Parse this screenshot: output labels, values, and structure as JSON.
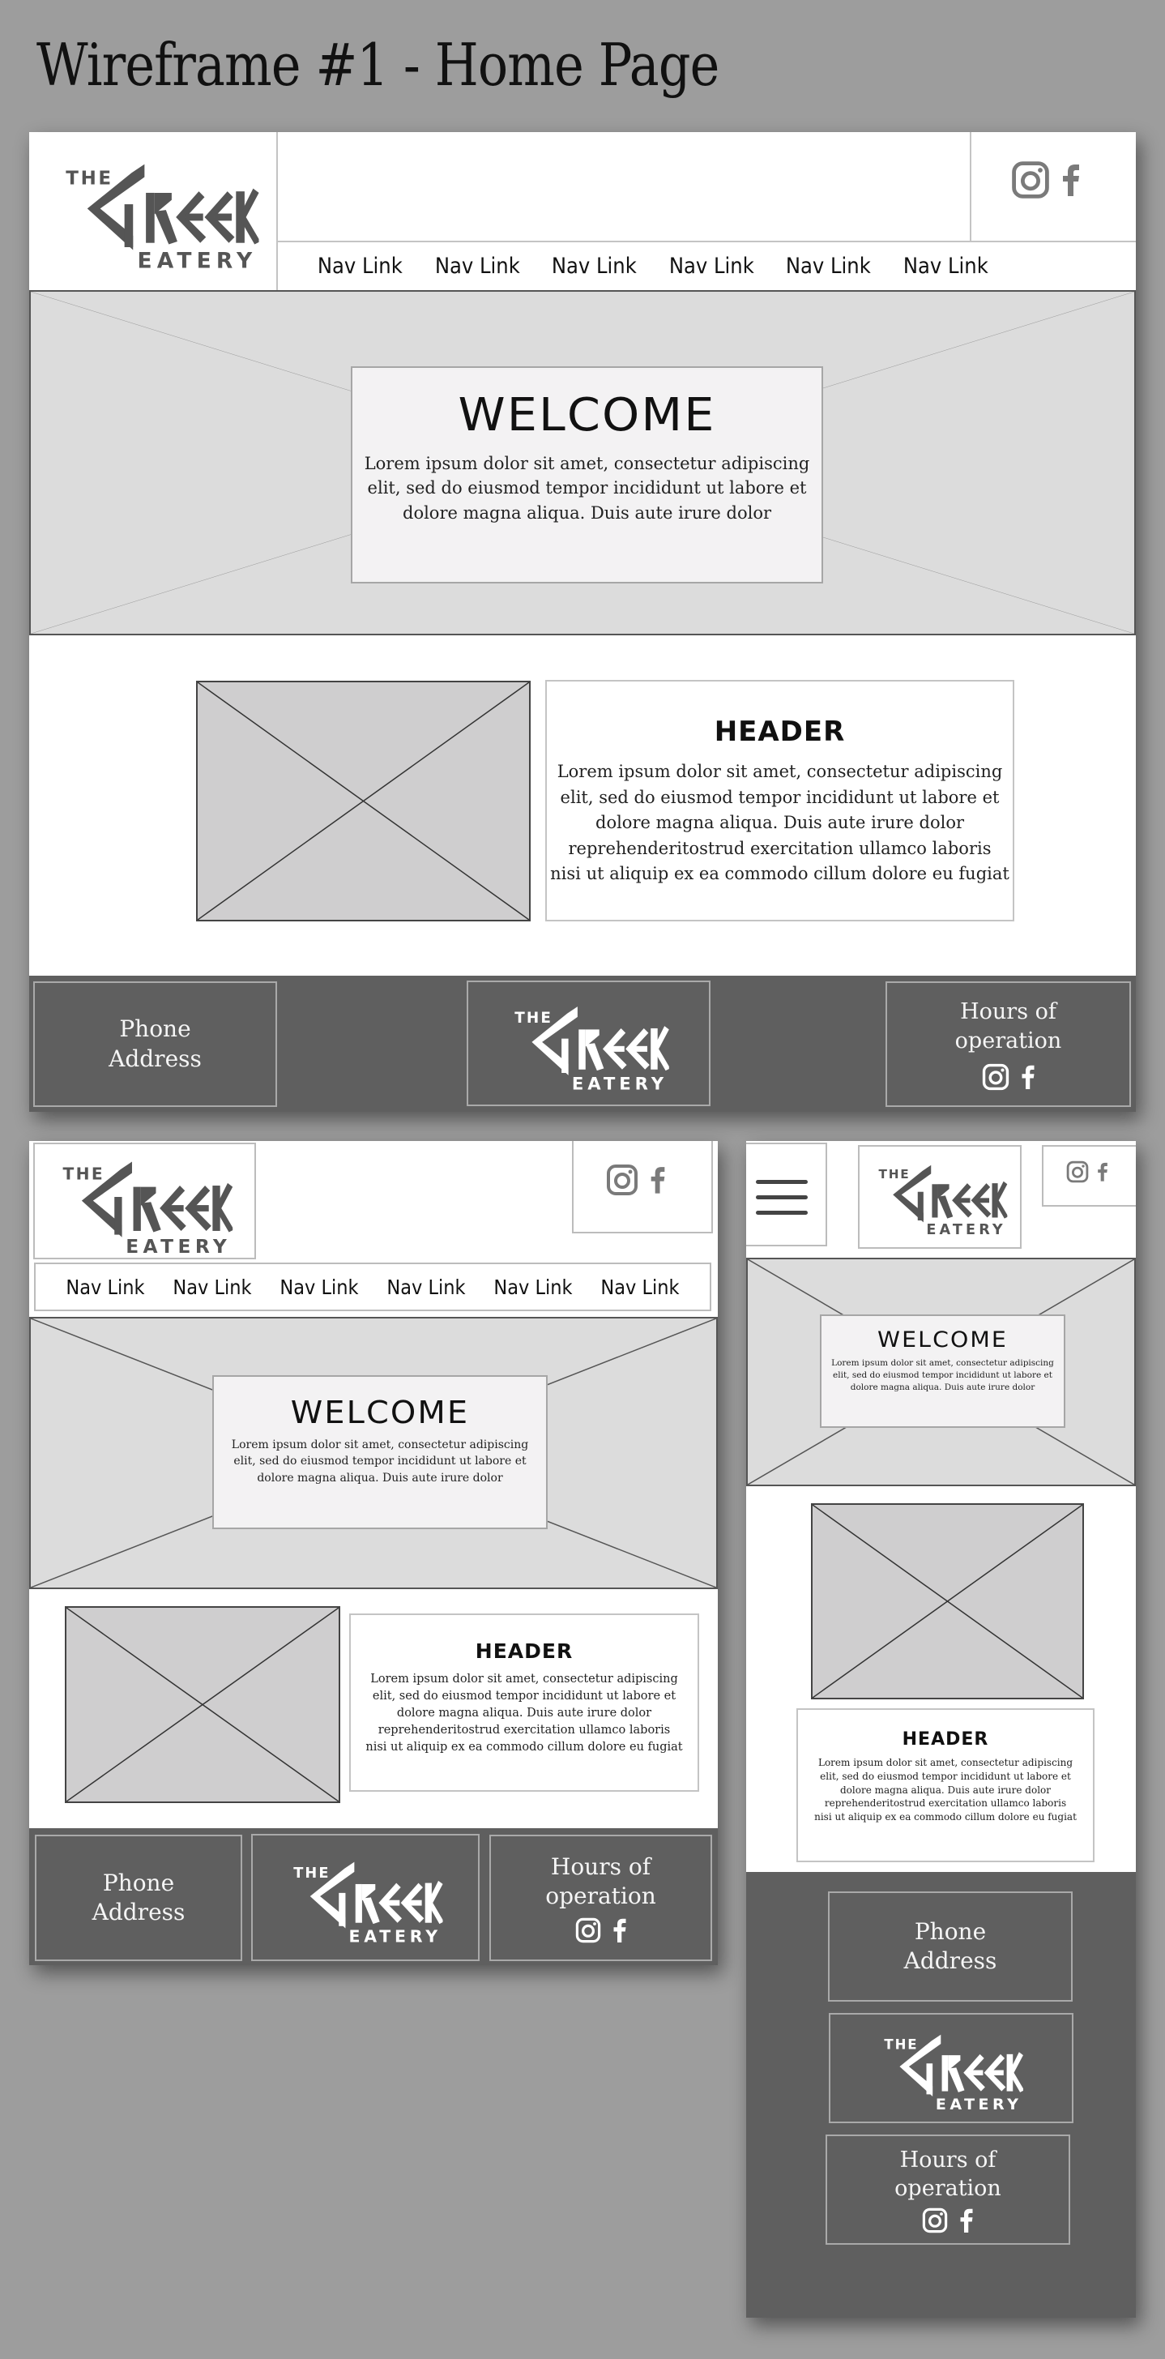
{
  "title": "Wireframe #1 - Home Page",
  "logo": {
    "top": "THE",
    "main": "GREEK",
    "bottom": "EATERY"
  },
  "social": {
    "instagram": "instagram-icon",
    "facebook": "facebook-icon"
  },
  "nav": {
    "links": [
      "Nav Link",
      "Nav Link",
      "Nav Link",
      "Nav Link",
      "Nav Link",
      "Nav Link"
    ]
  },
  "hero": {
    "heading": "WELCOME",
    "body_line1": "Lorem ipsum dolor sit amet, consectetur adipiscing",
    "body_line2": "elit, sed do eiusmod tempor incididunt ut labore et",
    "body_line3": "dolore magna aliqua. Duis aute irure dolor"
  },
  "feature": {
    "heading": "HEADER",
    "body_line1": "Lorem ipsum dolor sit amet, consectetur adipiscing",
    "body_line2": "elit, sed do eiusmod tempor incididunt ut labore et",
    "body_line3": "dolore magna aliqua. Duis aute irure dolor",
    "body_line4": "reprehenderitostrud exercitation ullamco laboris",
    "body_line5": "nisi ut aliquip ex ea commodo cillum dolore eu fugiat"
  },
  "footer": {
    "contact_line1": "Phone",
    "contact_line2": "Address",
    "hours_line1": "Hours of",
    "hours_line2": "operation"
  },
  "menu": {
    "icon": "hamburger-menu-icon"
  },
  "colors": {
    "background": "#9d9d9d",
    "hero_fill": "#dcdcdc",
    "image_placeholder": "#cfcecf",
    "footer": "#5f5f5f",
    "logo_gray": "#555555"
  }
}
